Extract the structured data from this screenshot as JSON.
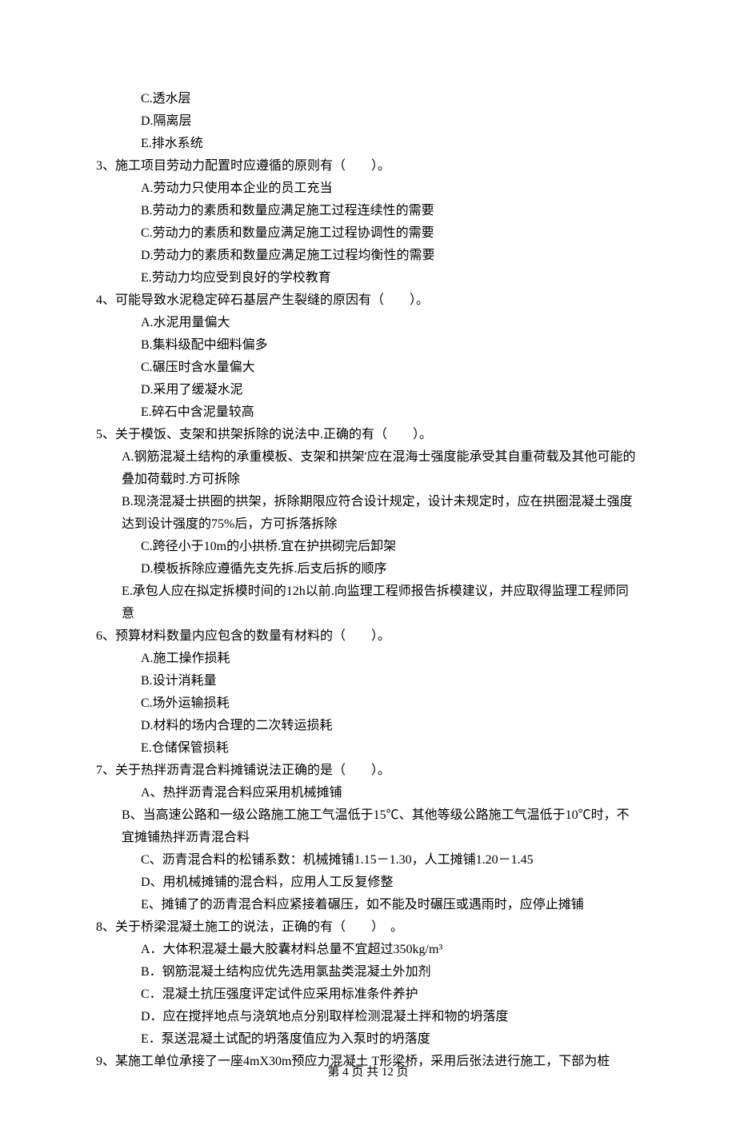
{
  "lines": [
    {
      "cls": "indent-option",
      "t": "C.透水层"
    },
    {
      "cls": "indent-option",
      "t": "D.隔离层"
    },
    {
      "cls": "indent-option",
      "t": "E.排水系统"
    },
    {
      "cls": "q-stem",
      "t": "3、施工项目劳动力配置时应遵循的原则有（　　）。"
    },
    {
      "cls": "indent-option",
      "t": "A.劳动力只使用本企业的员工充当"
    },
    {
      "cls": "indent-option",
      "t": "B.劳动力的素质和数量应满足施工过程连续性的需要"
    },
    {
      "cls": "indent-option",
      "t": "C.劳动力的素质和数量应满足施工过程协调性的需要"
    },
    {
      "cls": "indent-option",
      "t": "D.劳动力的素质和数量应满足施工过程均衡性的需要"
    },
    {
      "cls": "indent-option",
      "t": "E.劳动力均应受到良好的学校教育"
    },
    {
      "cls": "q-stem",
      "t": "4、可能导致水泥稳定碎石基层产生裂缝的原因有（　　）。"
    },
    {
      "cls": "indent-option",
      "t": "A.水泥用量偏大"
    },
    {
      "cls": "indent-option",
      "t": "B.集料级配中细料偏多"
    },
    {
      "cls": "indent-option",
      "t": "C.碾压时含水量偏大"
    },
    {
      "cls": "indent-option",
      "t": "D.采用了缓凝水泥"
    },
    {
      "cls": "indent-option",
      "t": "E.碎石中含泥量较高"
    },
    {
      "cls": "q-stem",
      "t": "5、关于模饭、支架和拱架拆除的说法中.正确的有（　　）。"
    },
    {
      "cls": "indent-body",
      "t": "A.钢筋混凝土结构的承重模板、支架和拱架'应在混海士强度能承受其自重荷载及其他可能的叠加荷载时.方可拆除"
    },
    {
      "cls": "indent-body",
      "t": "B.现浇混凝士拱圈的拱架，拆除期限应符合设计规定，设计未规定时，应在拱圈混凝土强度达到设计强度的75%后，方可拆落拆除"
    },
    {
      "cls": "indent-option",
      "t": "C.跨径小于10m的小拱桥.宜在护拱砌完后卸架"
    },
    {
      "cls": "indent-option",
      "t": "D.模板拆除应遵循先支先拆.后支后拆的顺序"
    },
    {
      "cls": "indent-body",
      "t": "E.承包人应在拟定拆模时间的12h以前.向监理工程师报告拆模建议，并应取得监理工程师同意"
    },
    {
      "cls": "q-stem",
      "t": "6、预算材料数量内应包含的数量有材料的（　　）。"
    },
    {
      "cls": "indent-option",
      "t": "A.施工操作损耗"
    },
    {
      "cls": "indent-option",
      "t": "B.设计消耗量"
    },
    {
      "cls": "indent-option",
      "t": "C.场外运输损耗"
    },
    {
      "cls": "indent-option",
      "t": "D.材料的场内合理的二次转运损耗"
    },
    {
      "cls": "indent-option",
      "t": "E.仓储保管损耗"
    },
    {
      "cls": "q-stem",
      "t": "7、关于热拌沥青混合料摊铺说法正确的是（　　）。"
    },
    {
      "cls": "indent-option",
      "t": "A、热拌沥青混合料应采用机械摊铺"
    },
    {
      "cls": "indent-body",
      "t": "B、当高速公路和一级公路施工施工气温低于15℃、其他等级公路施工气温低于10℃时，不宜摊铺热拌沥青混合料"
    },
    {
      "cls": "indent-option",
      "t": "C、沥青混合料的松铺系数：机械摊铺1.15－1.30，人工摊铺1.20－1.45"
    },
    {
      "cls": "indent-option",
      "t": "D、用机械摊铺的混合料，应用人工反复修整"
    },
    {
      "cls": "indent-option",
      "t": "E、摊铺了的沥青混合料应紧接着碾压，如不能及时碾压或遇雨时，应停止摊铺"
    },
    {
      "cls": "q-stem",
      "t": "8、关于桥梁混凝土施工的说法，正确的有（　　）  。"
    },
    {
      "cls": "indent-option",
      "t": "A．大体积混凝土最大胶囊材料总量不宜超过350kg/m³"
    },
    {
      "cls": "indent-option",
      "t": "B．钢筋混凝土结构应优先选用氯盐类混凝土外加剂"
    },
    {
      "cls": "indent-option",
      "t": "C．混凝土抗压强度评定试件应采用标准条件养护"
    },
    {
      "cls": "indent-option",
      "t": "D．应在搅拌地点与浇筑地点分别取样检测混凝土拌和物的坍落度"
    },
    {
      "cls": "indent-option",
      "t": "E．泵送混凝土试配的坍落度值应为入泵时的坍落度"
    },
    {
      "cls": "q-stem",
      "t": "9、某施工单位承接了一座4mX30m预应力混凝土 T形梁桥，采用后张法进行施工，下部为桩"
    }
  ],
  "footer": "第 4 页 共 12 页"
}
